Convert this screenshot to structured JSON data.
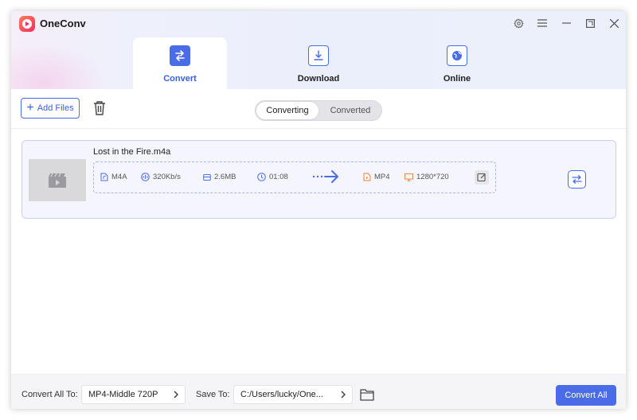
{
  "app": {
    "title": "OneConv"
  },
  "tabs": [
    {
      "label": "Convert",
      "active": true
    },
    {
      "label": "Download",
      "active": false
    },
    {
      "label": "Online",
      "active": false
    }
  ],
  "toolbar": {
    "add_files_label": "Add Files",
    "segment": {
      "converting": "Converting",
      "converted": "Converted",
      "selected": "Converting"
    }
  },
  "file": {
    "name": "Lost in the Fire.m4a",
    "source": {
      "format": "M4A",
      "bitrate": "320Kb/s",
      "size": "2.6MB",
      "duration": "01:08"
    },
    "target": {
      "format": "MP4",
      "resolution": "1280*720"
    }
  },
  "footer": {
    "convert_all_to_label": "Convert All To:",
    "convert_all_to_value": "MP4-Middle 720P",
    "save_to_label": "Save To:",
    "save_to_value": "C:/Users/lucky/One...",
    "convert_all_button": "Convert All"
  },
  "colors": {
    "accent": "#4b6ce8",
    "target_format": "#e8843a",
    "logo": "#f2305f"
  },
  "icons": [
    "settings-icon",
    "menu-icon",
    "minimize-icon",
    "maximize-icon",
    "close-icon",
    "trash-icon",
    "video-thumbnail-icon",
    "swap-icon",
    "edit-icon",
    "folder-icon"
  ]
}
